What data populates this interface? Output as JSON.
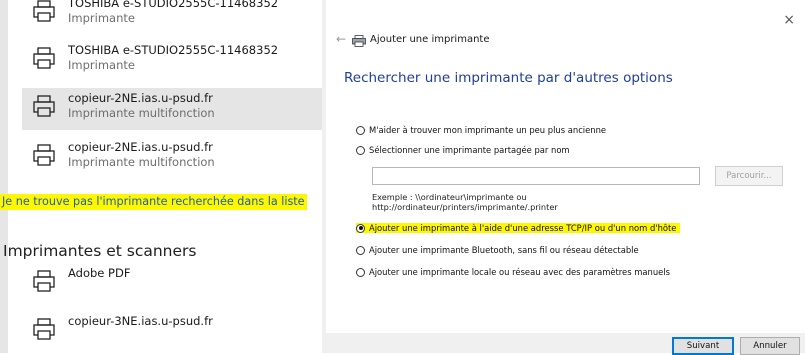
{
  "left_pane": {
    "printers": [
      {
        "name": "TOSHIBA e-STUDIO2555C-11468352",
        "type": "Imprimante"
      },
      {
        "name": "TOSHIBA e-STUDIO2555C-11468352",
        "type": "Imprimante"
      },
      {
        "name": "copieur-2NE.ias.u-psud.fr",
        "type": "Imprimante multifonction"
      },
      {
        "name": "copieur-2NE.ias.u-psud.fr",
        "type": "Imprimante multifonction"
      }
    ],
    "not_found_link": "Je ne trouve pas l'imprimante recherchée dans la liste",
    "section_heading": "Imprimantes et scanners",
    "section_printers": [
      {
        "name": "Adobe PDF"
      },
      {
        "name": "copieur-3NE.ias.u-psud.fr"
      }
    ]
  },
  "dialog": {
    "title": "Ajouter une imprimante",
    "close_symbol": "×",
    "back_symbol": "←",
    "heading": "Rechercher une imprimante par d'autres options",
    "options": [
      {
        "label": "M'aider à trouver mon imprimante un peu plus ancienne",
        "checked": false
      },
      {
        "label": "Sélectionner une imprimante partagée par nom",
        "checked": false
      },
      {
        "label": "Ajouter une imprimante à l'aide d'une adresse TCP/IP ou d'un nom d'hôte",
        "checked": true
      },
      {
        "label": "Ajouter une imprimante Bluetooth, sans fil ou réseau détectable",
        "checked": false
      },
      {
        "label": "Ajouter une imprimante locale ou réseau avec des paramètres manuels",
        "checked": false
      }
    ],
    "shared_input_value": "",
    "browse_label": "Parcourir...",
    "example_line1": "Exemple : \\\\ordinateur\\imprimante ou",
    "example_line2": "http://ordinateur/printers/imprimante/.printer",
    "next_label": "Suivant",
    "cancel_label": "Annuler"
  },
  "colors": {
    "heading_blue": "#1e3f9a",
    "link_blue": "#1b5fb7",
    "highlight_yellow": "#fff700",
    "selected_row": "#e5e5e5"
  }
}
